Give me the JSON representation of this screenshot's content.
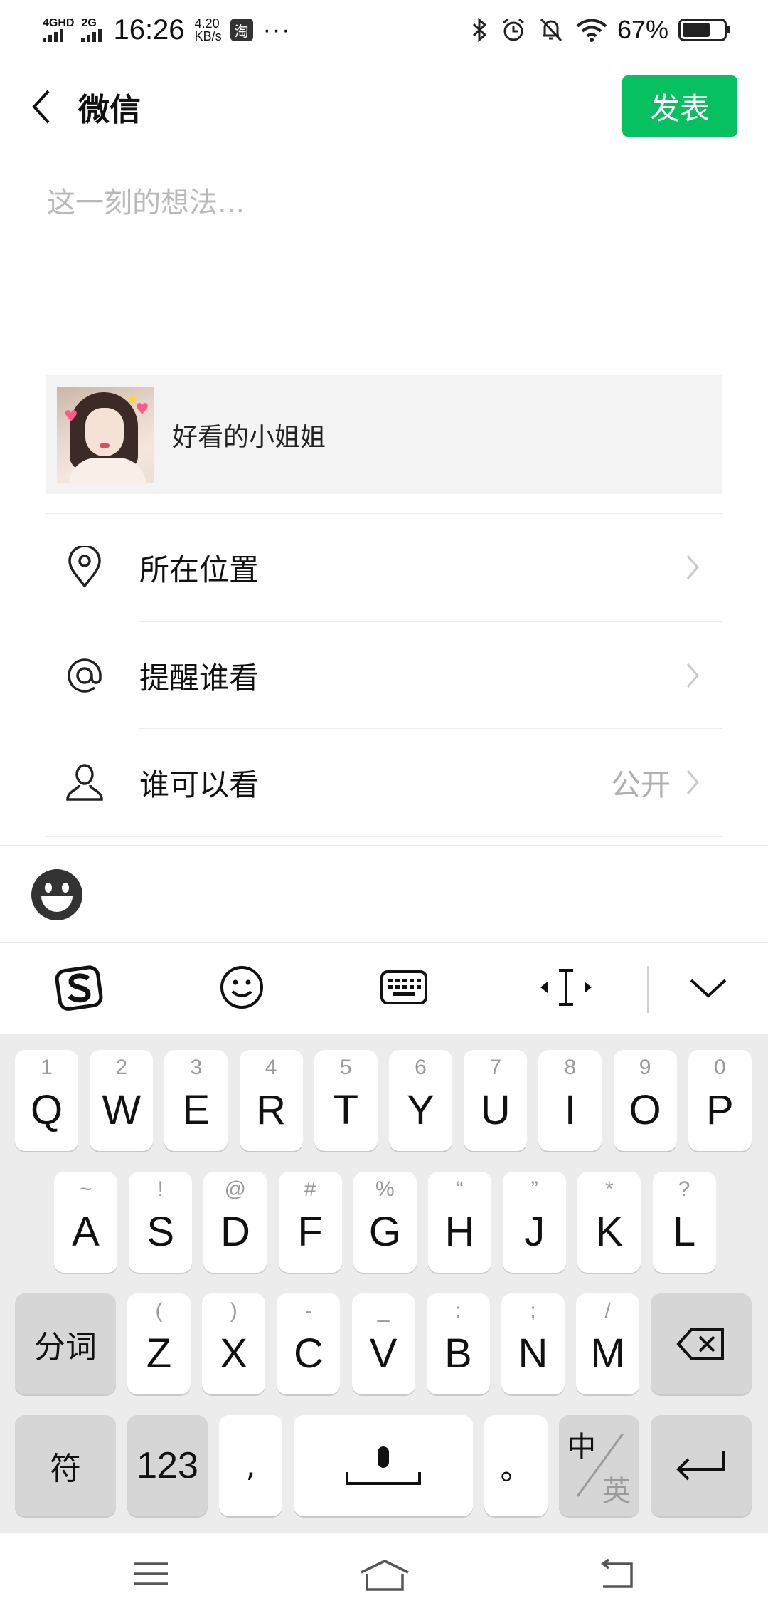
{
  "status_bar": {
    "network1": "4GHD",
    "network2": "2G",
    "time": "16:26",
    "speed_value": "4.20",
    "speed_unit": "KB/s",
    "taobao_badge": "淘",
    "more": "···",
    "battery_pct": "67%",
    "battery_level": 0.67
  },
  "header": {
    "title": "微信",
    "publish_label": "发表"
  },
  "composer": {
    "placeholder": "这一刻的想法..."
  },
  "share_card": {
    "title": "好看的小姐姐"
  },
  "options": [
    {
      "label": "所在位置",
      "value": "",
      "icon": "location-pin-icon"
    },
    {
      "label": "提醒谁看",
      "value": "",
      "icon": "at-icon"
    },
    {
      "label": "谁可以看",
      "value": "公开",
      "icon": "person-icon"
    }
  ],
  "keyboard": {
    "row1": [
      {
        "main": "Q",
        "hint": "1"
      },
      {
        "main": "W",
        "hint": "2"
      },
      {
        "main": "E",
        "hint": "3"
      },
      {
        "main": "R",
        "hint": "4"
      },
      {
        "main": "T",
        "hint": "5"
      },
      {
        "main": "Y",
        "hint": "6"
      },
      {
        "main": "U",
        "hint": "7"
      },
      {
        "main": "I",
        "hint": "8"
      },
      {
        "main": "O",
        "hint": "9"
      },
      {
        "main": "P",
        "hint": "0"
      }
    ],
    "row2": [
      {
        "main": "A",
        "hint": "~"
      },
      {
        "main": "S",
        "hint": "!"
      },
      {
        "main": "D",
        "hint": "@"
      },
      {
        "main": "F",
        "hint": "#"
      },
      {
        "main": "G",
        "hint": "%"
      },
      {
        "main": "H",
        "hint": "“"
      },
      {
        "main": "J",
        "hint": "”"
      },
      {
        "main": "K",
        "hint": "*"
      },
      {
        "main": "L",
        "hint": "?"
      }
    ],
    "row3": [
      {
        "main": "Z",
        "hint": "("
      },
      {
        "main": "X",
        "hint": ")"
      },
      {
        "main": "C",
        "hint": "-"
      },
      {
        "main": "V",
        "hint": "_"
      },
      {
        "main": "B",
        "hint": ":"
      },
      {
        "main": "N",
        "hint": ";"
      },
      {
        "main": "M",
        "hint": "/"
      }
    ],
    "segment_label": "分词",
    "symbol_label": "符",
    "num_label": "123",
    "comma_label": ",",
    "period_label": "。",
    "lang_cn": "中",
    "lang_en": "英"
  }
}
